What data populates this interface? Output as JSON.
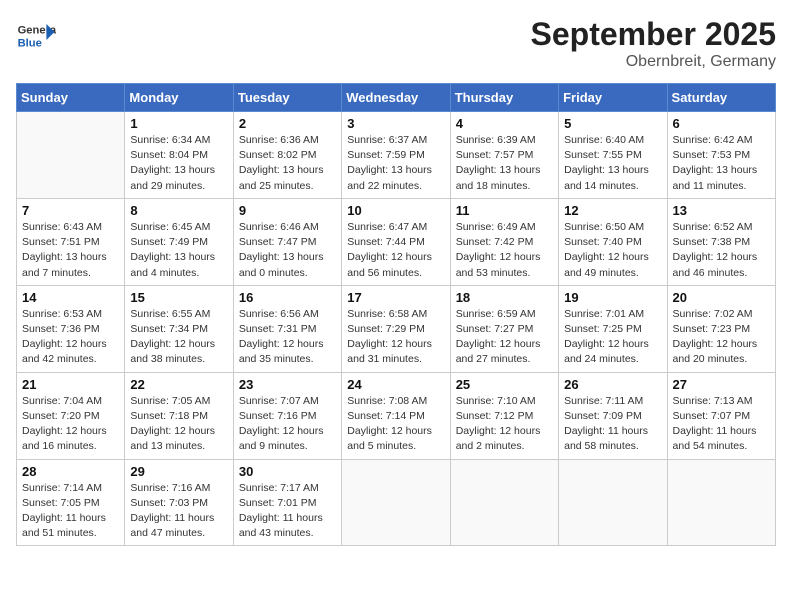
{
  "header": {
    "logo_general": "General",
    "logo_blue": "Blue",
    "month_year": "September 2025",
    "location": "Obernbreit, Germany"
  },
  "weekdays": [
    "Sunday",
    "Monday",
    "Tuesday",
    "Wednesday",
    "Thursday",
    "Friday",
    "Saturday"
  ],
  "weeks": [
    [
      {
        "day": "",
        "sunrise": "",
        "sunset": "",
        "daylight": ""
      },
      {
        "day": "1",
        "sunrise": "Sunrise: 6:34 AM",
        "sunset": "Sunset: 8:04 PM",
        "daylight": "Daylight: 13 hours and 29 minutes."
      },
      {
        "day": "2",
        "sunrise": "Sunrise: 6:36 AM",
        "sunset": "Sunset: 8:02 PM",
        "daylight": "Daylight: 13 hours and 25 minutes."
      },
      {
        "day": "3",
        "sunrise": "Sunrise: 6:37 AM",
        "sunset": "Sunset: 7:59 PM",
        "daylight": "Daylight: 13 hours and 22 minutes."
      },
      {
        "day": "4",
        "sunrise": "Sunrise: 6:39 AM",
        "sunset": "Sunset: 7:57 PM",
        "daylight": "Daylight: 13 hours and 18 minutes."
      },
      {
        "day": "5",
        "sunrise": "Sunrise: 6:40 AM",
        "sunset": "Sunset: 7:55 PM",
        "daylight": "Daylight: 13 hours and 14 minutes."
      },
      {
        "day": "6",
        "sunrise": "Sunrise: 6:42 AM",
        "sunset": "Sunset: 7:53 PM",
        "daylight": "Daylight: 13 hours and 11 minutes."
      }
    ],
    [
      {
        "day": "7",
        "sunrise": "Sunrise: 6:43 AM",
        "sunset": "Sunset: 7:51 PM",
        "daylight": "Daylight: 13 hours and 7 minutes."
      },
      {
        "day": "8",
        "sunrise": "Sunrise: 6:45 AM",
        "sunset": "Sunset: 7:49 PM",
        "daylight": "Daylight: 13 hours and 4 minutes."
      },
      {
        "day": "9",
        "sunrise": "Sunrise: 6:46 AM",
        "sunset": "Sunset: 7:47 PM",
        "daylight": "Daylight: 13 hours and 0 minutes."
      },
      {
        "day": "10",
        "sunrise": "Sunrise: 6:47 AM",
        "sunset": "Sunset: 7:44 PM",
        "daylight": "Daylight: 12 hours and 56 minutes."
      },
      {
        "day": "11",
        "sunrise": "Sunrise: 6:49 AM",
        "sunset": "Sunset: 7:42 PM",
        "daylight": "Daylight: 12 hours and 53 minutes."
      },
      {
        "day": "12",
        "sunrise": "Sunrise: 6:50 AM",
        "sunset": "Sunset: 7:40 PM",
        "daylight": "Daylight: 12 hours and 49 minutes."
      },
      {
        "day": "13",
        "sunrise": "Sunrise: 6:52 AM",
        "sunset": "Sunset: 7:38 PM",
        "daylight": "Daylight: 12 hours and 46 minutes."
      }
    ],
    [
      {
        "day": "14",
        "sunrise": "Sunrise: 6:53 AM",
        "sunset": "Sunset: 7:36 PM",
        "daylight": "Daylight: 12 hours and 42 minutes."
      },
      {
        "day": "15",
        "sunrise": "Sunrise: 6:55 AM",
        "sunset": "Sunset: 7:34 PM",
        "daylight": "Daylight: 12 hours and 38 minutes."
      },
      {
        "day": "16",
        "sunrise": "Sunrise: 6:56 AM",
        "sunset": "Sunset: 7:31 PM",
        "daylight": "Daylight: 12 hours and 35 minutes."
      },
      {
        "day": "17",
        "sunrise": "Sunrise: 6:58 AM",
        "sunset": "Sunset: 7:29 PM",
        "daylight": "Daylight: 12 hours and 31 minutes."
      },
      {
        "day": "18",
        "sunrise": "Sunrise: 6:59 AM",
        "sunset": "Sunset: 7:27 PM",
        "daylight": "Daylight: 12 hours and 27 minutes."
      },
      {
        "day": "19",
        "sunrise": "Sunrise: 7:01 AM",
        "sunset": "Sunset: 7:25 PM",
        "daylight": "Daylight: 12 hours and 24 minutes."
      },
      {
        "day": "20",
        "sunrise": "Sunrise: 7:02 AM",
        "sunset": "Sunset: 7:23 PM",
        "daylight": "Daylight: 12 hours and 20 minutes."
      }
    ],
    [
      {
        "day": "21",
        "sunrise": "Sunrise: 7:04 AM",
        "sunset": "Sunset: 7:20 PM",
        "daylight": "Daylight: 12 hours and 16 minutes."
      },
      {
        "day": "22",
        "sunrise": "Sunrise: 7:05 AM",
        "sunset": "Sunset: 7:18 PM",
        "daylight": "Daylight: 12 hours and 13 minutes."
      },
      {
        "day": "23",
        "sunrise": "Sunrise: 7:07 AM",
        "sunset": "Sunset: 7:16 PM",
        "daylight": "Daylight: 12 hours and 9 minutes."
      },
      {
        "day": "24",
        "sunrise": "Sunrise: 7:08 AM",
        "sunset": "Sunset: 7:14 PM",
        "daylight": "Daylight: 12 hours and 5 minutes."
      },
      {
        "day": "25",
        "sunrise": "Sunrise: 7:10 AM",
        "sunset": "Sunset: 7:12 PM",
        "daylight": "Daylight: 12 hours and 2 minutes."
      },
      {
        "day": "26",
        "sunrise": "Sunrise: 7:11 AM",
        "sunset": "Sunset: 7:09 PM",
        "daylight": "Daylight: 11 hours and 58 minutes."
      },
      {
        "day": "27",
        "sunrise": "Sunrise: 7:13 AM",
        "sunset": "Sunset: 7:07 PM",
        "daylight": "Daylight: 11 hours and 54 minutes."
      }
    ],
    [
      {
        "day": "28",
        "sunrise": "Sunrise: 7:14 AM",
        "sunset": "Sunset: 7:05 PM",
        "daylight": "Daylight: 11 hours and 51 minutes."
      },
      {
        "day": "29",
        "sunrise": "Sunrise: 7:16 AM",
        "sunset": "Sunset: 7:03 PM",
        "daylight": "Daylight: 11 hours and 47 minutes."
      },
      {
        "day": "30",
        "sunrise": "Sunrise: 7:17 AM",
        "sunset": "Sunset: 7:01 PM",
        "daylight": "Daylight: 11 hours and 43 minutes."
      },
      {
        "day": "",
        "sunrise": "",
        "sunset": "",
        "daylight": ""
      },
      {
        "day": "",
        "sunrise": "",
        "sunset": "",
        "daylight": ""
      },
      {
        "day": "",
        "sunrise": "",
        "sunset": "",
        "daylight": ""
      },
      {
        "day": "",
        "sunrise": "",
        "sunset": "",
        "daylight": ""
      }
    ]
  ]
}
